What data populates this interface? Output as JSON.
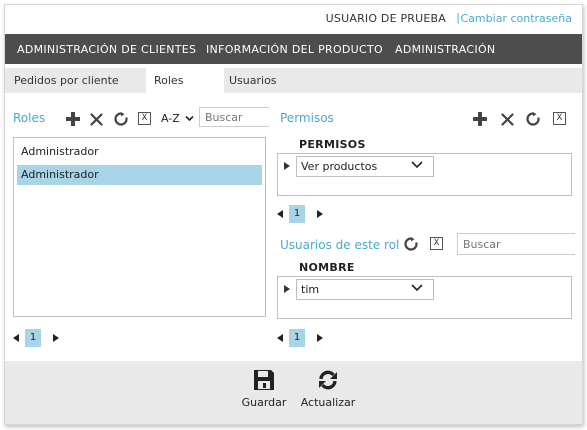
{
  "header": {
    "user_label": "USUARIO DE PRUEBA",
    "separator": "|",
    "change_password": "Cambiar contraseña"
  },
  "menu": [
    {
      "label": "ADMINISTRACIÓN DE CLIENTES"
    },
    {
      "label": "INFORMACIÓN DEL PRODUCTO"
    },
    {
      "label": "ADMINISTRACIÓN"
    }
  ],
  "tabs": [
    {
      "label": "Pedidos por cliente",
      "active": false
    },
    {
      "label": "Roles",
      "active": true
    },
    {
      "label": "Usuarios",
      "active": false
    }
  ],
  "roles_panel": {
    "title": "Roles",
    "sort_label": "A-Z",
    "search_placeholder": "Buscar",
    "items": [
      {
        "label": "Administrador",
        "selected": false
      },
      {
        "label": "Administrador",
        "selected": true
      }
    ],
    "page": "1"
  },
  "permisos_panel": {
    "title": "Permisos",
    "column": "PERMISOS",
    "rows": [
      {
        "value": "Ver productos"
      }
    ],
    "page": "1"
  },
  "users_panel": {
    "title": "Usuarios de este rol",
    "search_placeholder": "Buscar",
    "column": "NOMBRE",
    "rows": [
      {
        "value": "tim"
      }
    ],
    "page": "1"
  },
  "footer": {
    "save_label": "Guardar",
    "refresh_label": "Actualizar"
  },
  "icons": {
    "add": "plus-icon",
    "delete": "cross-icon",
    "refresh": "refresh-icon",
    "excel": "excel-export-icon",
    "save": "floppy-disk-icon",
    "reload": "sync-icon"
  },
  "colors": {
    "accent": "#4aa8d0",
    "menu_bg": "#4d4d4d",
    "selected": "#a8d4e8",
    "tab_bg": "#e9e9e9"
  }
}
